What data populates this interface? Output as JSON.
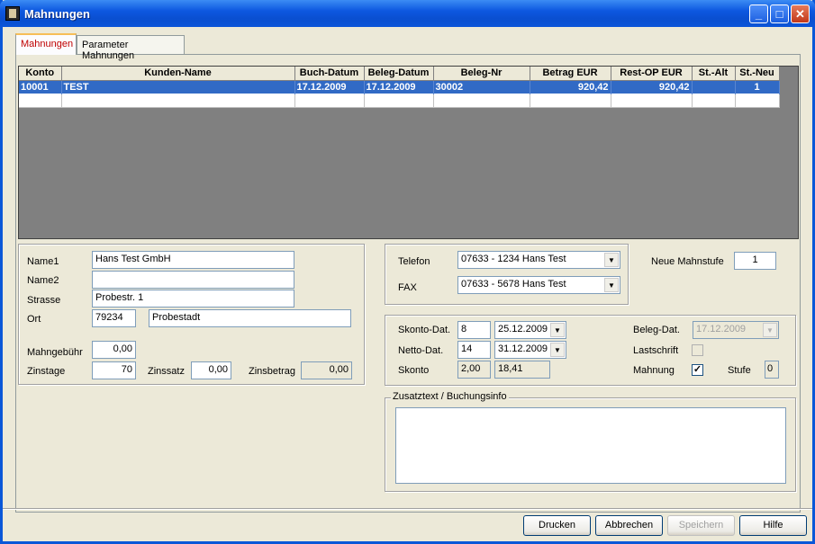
{
  "window": {
    "title": "Mahnungen"
  },
  "tabs": [
    {
      "label": "Mahnungen"
    },
    {
      "label": "Parameter Mahnungen"
    }
  ],
  "grid": {
    "columns": [
      "Konto",
      "Kunden-Name",
      "Buch-Datum",
      "Beleg-Datum",
      "Beleg-Nr",
      "Betrag EUR",
      "Rest-OP EUR",
      "St.-Alt",
      "St.-Neu"
    ],
    "rows": [
      {
        "konto": "10001",
        "kunde": "TEST",
        "buch": "17.12.2009",
        "beleg_datum": "17.12.2009",
        "beleg_nr": "30002",
        "betrag": "920,42",
        "rest": "920,42",
        "alt": "",
        "neu": "1"
      }
    ]
  },
  "address": {
    "name1_label": "Name1",
    "name1": "Hans Test GmbH",
    "name2_label": "Name2",
    "name2": "",
    "strasse_label": "Strasse",
    "strasse": "Probestr. 1",
    "ort_label": "Ort",
    "plz": "79234",
    "ort": "Probestadt",
    "mahngebuehr_label": "Mahngebühr",
    "mahngebuehr": "0,00",
    "zinstage_label": "Zinstage",
    "zinstage": "70",
    "zinssatz_label": "Zinssatz",
    "zinssatz": "0,00",
    "zinsbetrag_label": "Zinsbetrag",
    "zinsbetrag": "0,00"
  },
  "contact": {
    "telefon_label": "Telefon",
    "telefon": "07633 - 1234 Hans Test",
    "fax_label": "FAX",
    "fax": "07633 - 5678 Hans Test"
  },
  "mahnstufe": {
    "label": "Neue Mahnstufe",
    "value": "1"
  },
  "terms": {
    "skonto_dat_label": "Skonto-Dat.",
    "skonto_days": "8",
    "skonto_date": "25.12.2009",
    "netto_dat_label": "Netto-Dat.",
    "netto_days": "14",
    "netto_date": "31.12.2009",
    "skonto_label": "Skonto",
    "skonto_pct": "2,00",
    "skonto_amount": "18,41",
    "beleg_dat_label": "Beleg-Dat.",
    "beleg_dat": "17.12.2009",
    "lastschrift_label": "Lastschrift",
    "lastschrift": false,
    "mahnung_label": "Mahnung",
    "mahnung": true,
    "stufe_label": "Stufe",
    "stufe": "0"
  },
  "zusatztext": {
    "label": "Zusatztext / Buchungsinfo",
    "value": ""
  },
  "buttons": {
    "drucken": "Drucken",
    "abbrechen": "Abbrechen",
    "speichern": "Speichern",
    "hilfe": "Hilfe"
  },
  "colors": {
    "selection": "#316AC5",
    "titlebar": "#0A57D8",
    "face": "#ECE9D8",
    "active_tab_text": "#C00000"
  }
}
